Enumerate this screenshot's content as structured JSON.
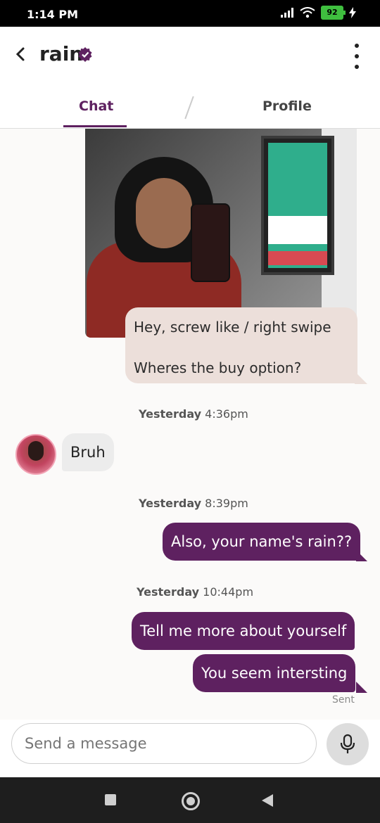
{
  "status_bar": {
    "time": "1:14 PM",
    "battery": "92",
    "icons": [
      "signal-icon",
      "wifi-icon",
      "battery-icon",
      "charging-icon"
    ]
  },
  "header": {
    "back_icon": "chevron-left-icon",
    "contact_name": "rain",
    "verified_icon": "verified-badge-icon",
    "more_icon": "more-vertical-icon"
  },
  "tabs": [
    {
      "label": "Chat",
      "active": true
    },
    {
      "label": "Profile",
      "active": false
    }
  ],
  "messages": {
    "image_caption_line1": "Hey, screw like / right swipe",
    "image_caption_line2": "Wheres the buy option?",
    "ts1_day": "Yesterday",
    "ts1_time": "4:36pm",
    "recv1": "Bruh",
    "ts2_day": "Yesterday",
    "ts2_time": "8:39pm",
    "sent1": "Also, your name's rain??",
    "ts3_day": "Yesterday",
    "ts3_time": "10:44pm",
    "sent2": "Tell me more about yourself",
    "sent3": "You seem intersting",
    "sent_status": "Sent"
  },
  "composer": {
    "placeholder": "Send a message",
    "mic_icon": "microphone-icon"
  },
  "colors": {
    "accent": "#5e2160",
    "light_bubble": "#ecdfda",
    "recv_bubble": "#ececec"
  }
}
